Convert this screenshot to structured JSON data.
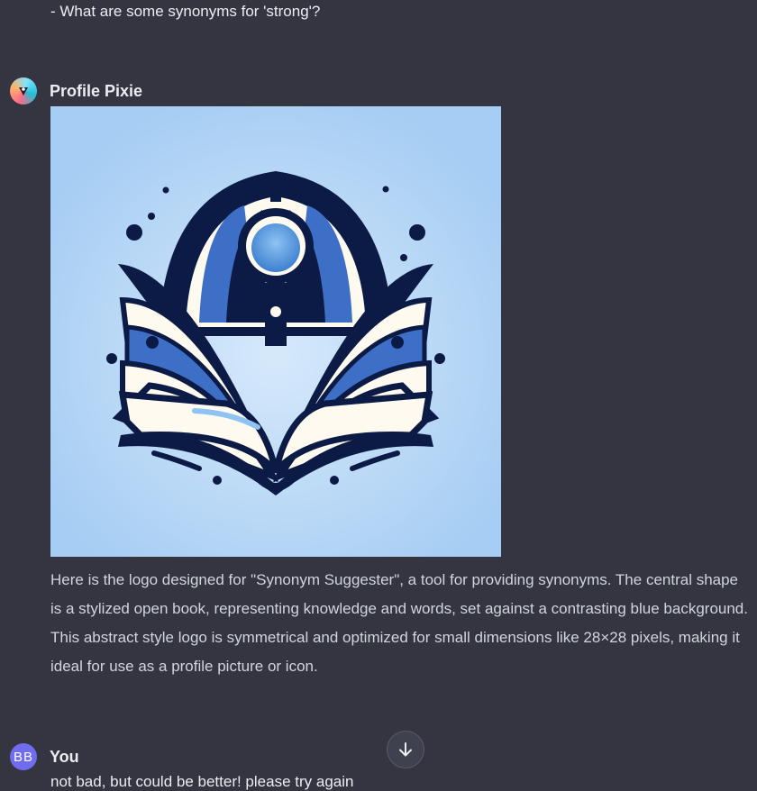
{
  "previous_message": {
    "text": "- What are some synonyms for 'strong'?"
  },
  "assistant": {
    "name": "Profile Pixie",
    "avatar_icon": "profile-pixie-logo-icon",
    "image": {
      "subject": "open-book-logo-icon",
      "colors": [
        "#a9cff2",
        "#0b1b45",
        "#3d6fc6",
        "#fffaf0"
      ]
    },
    "message": "Here is the logo designed for \"Synonym Suggester\", a tool for providing synonyms. The central shape is a stylized open book, representing knowledge and words, set against a contrasting blue background. This abstract style logo is symmetrical and optimized for small dimensions like 28×28 pixels, making it ideal for use as a profile picture or icon."
  },
  "user": {
    "name": "You",
    "initials": "BB",
    "message": "not bad, but could be better! please try again"
  },
  "scroll_button": {
    "icon": "arrow-down-icon"
  },
  "colors": {
    "background": "#343541",
    "text": "#ececf1",
    "user_avatar": "#6f6cf0",
    "image_background": "#a9cff2"
  }
}
